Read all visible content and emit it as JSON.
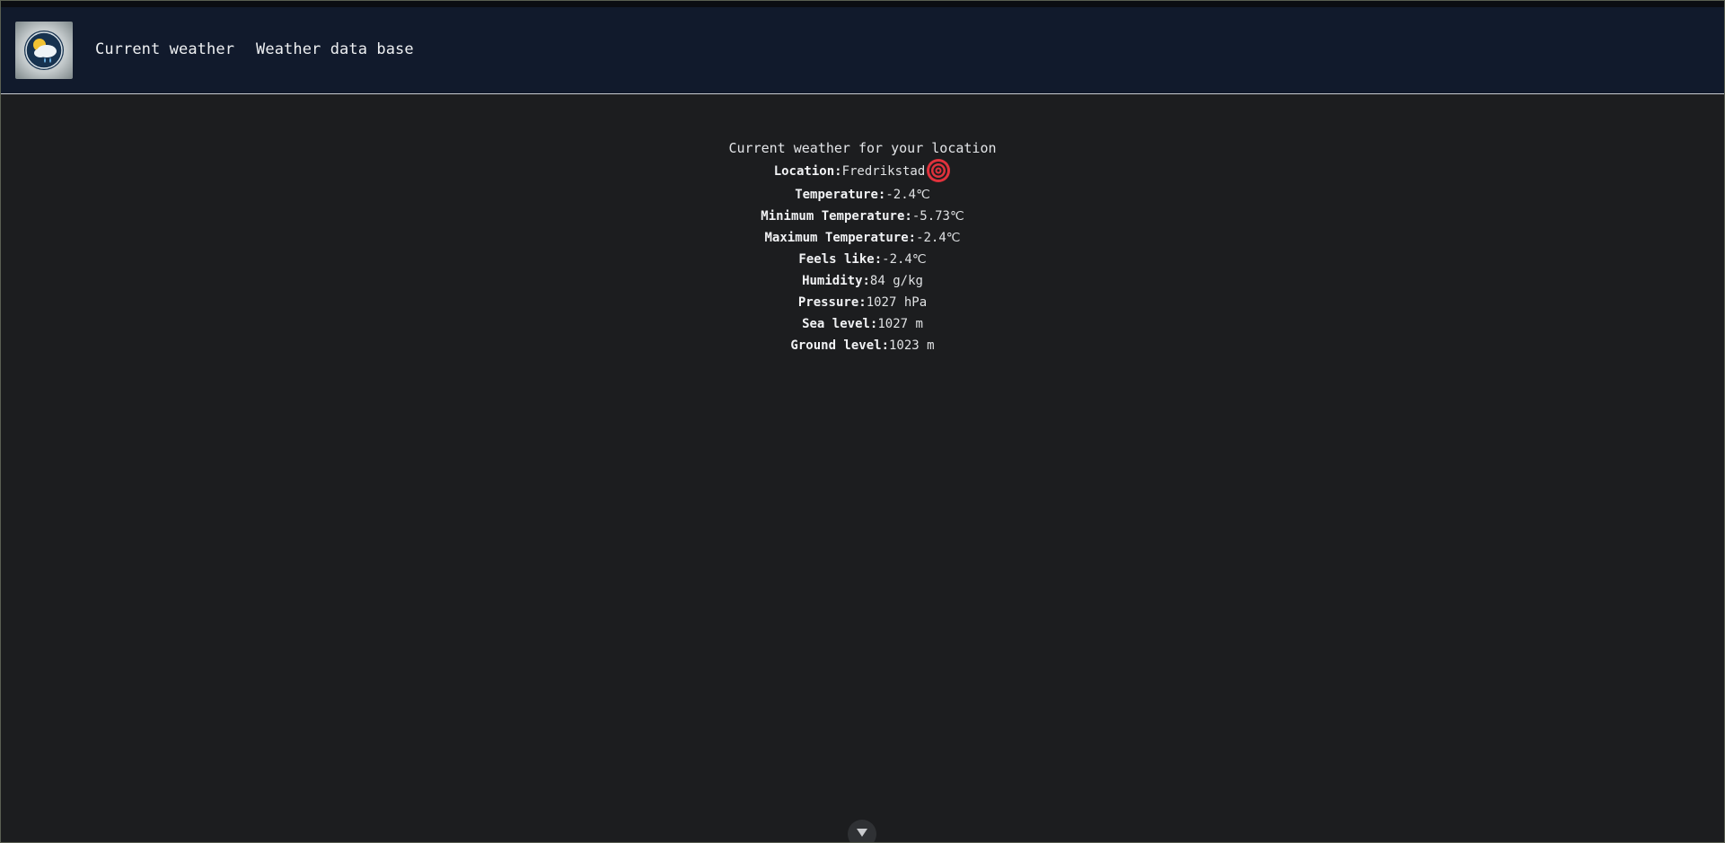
{
  "navbar": {
    "logo_icon": "weather-app-logo-icon",
    "links": [
      {
        "label": "Current weather"
      },
      {
        "label": "Weather data base"
      }
    ]
  },
  "weather": {
    "heading": "Current weather for your location",
    "location": {
      "label": "Location:",
      "value": "Fredrikstad",
      "icon": "target-location-icon"
    },
    "rows": [
      {
        "label": "Temperature:",
        "value": "-2.4℃"
      },
      {
        "label": "Minimum Temperature:",
        "value": "-5.73℃"
      },
      {
        "label": "Maximum Temperature:",
        "value": "-2.4℃"
      },
      {
        "label": "Feels like:",
        "value": "-2.4℃"
      },
      {
        "label": "Humidity:",
        "value": "84 g/kg"
      },
      {
        "label": "Pressure:",
        "value": "1027 hPa"
      },
      {
        "label": "Sea level:",
        "value": "1027 m"
      },
      {
        "label": "Ground level:",
        "value": "1023 m"
      }
    ]
  },
  "scroll_button": {
    "icon": "chevron-down-icon"
  },
  "colors": {
    "background": "#1c1d1f",
    "navbar": "#111a2c",
    "target_icon": "#e0323c"
  }
}
